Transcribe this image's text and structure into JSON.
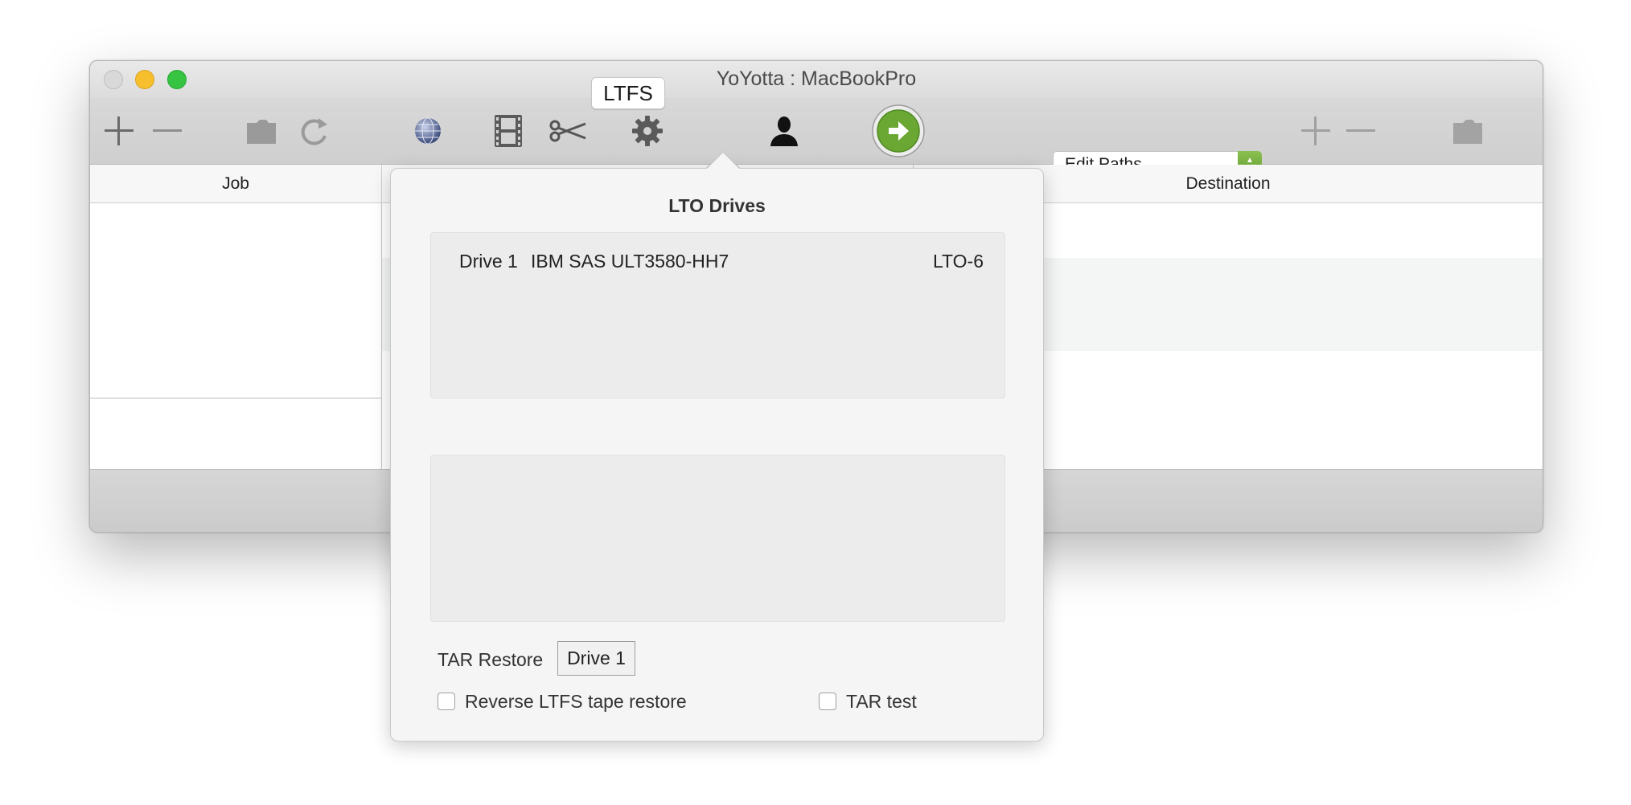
{
  "window": {
    "title": "YoYotta : MacBookPro"
  },
  "toolbar": {
    "ltfs_label": "LTFS",
    "edit_paths": "Edit Paths...",
    "icons": [
      "add-icon",
      "remove-icon",
      "folder-icon",
      "refresh-icon",
      "network-globe-icon",
      "film-icon",
      "scissors-icon",
      "gear-icon",
      "user-icon",
      "go-arrow-icon",
      "add-icon",
      "remove-icon",
      "folder-icon"
    ]
  },
  "table": {
    "columns": [
      "Job",
      "Destination"
    ]
  },
  "popover": {
    "title": "LTO Drives",
    "drives": [
      {
        "name": "Drive 1",
        "model": "IBM SAS ULT3580-HH7",
        "type": "LTO-6"
      }
    ],
    "tar_restore_label": "TAR Restore",
    "tar_restore_value": "Drive 1",
    "reverse_ltfs_label": "Reverse LTFS tape restore",
    "tar_test_label": "TAR test"
  },
  "colors": {
    "go_button": "#6aa733",
    "stepper": "#6fa83a"
  }
}
